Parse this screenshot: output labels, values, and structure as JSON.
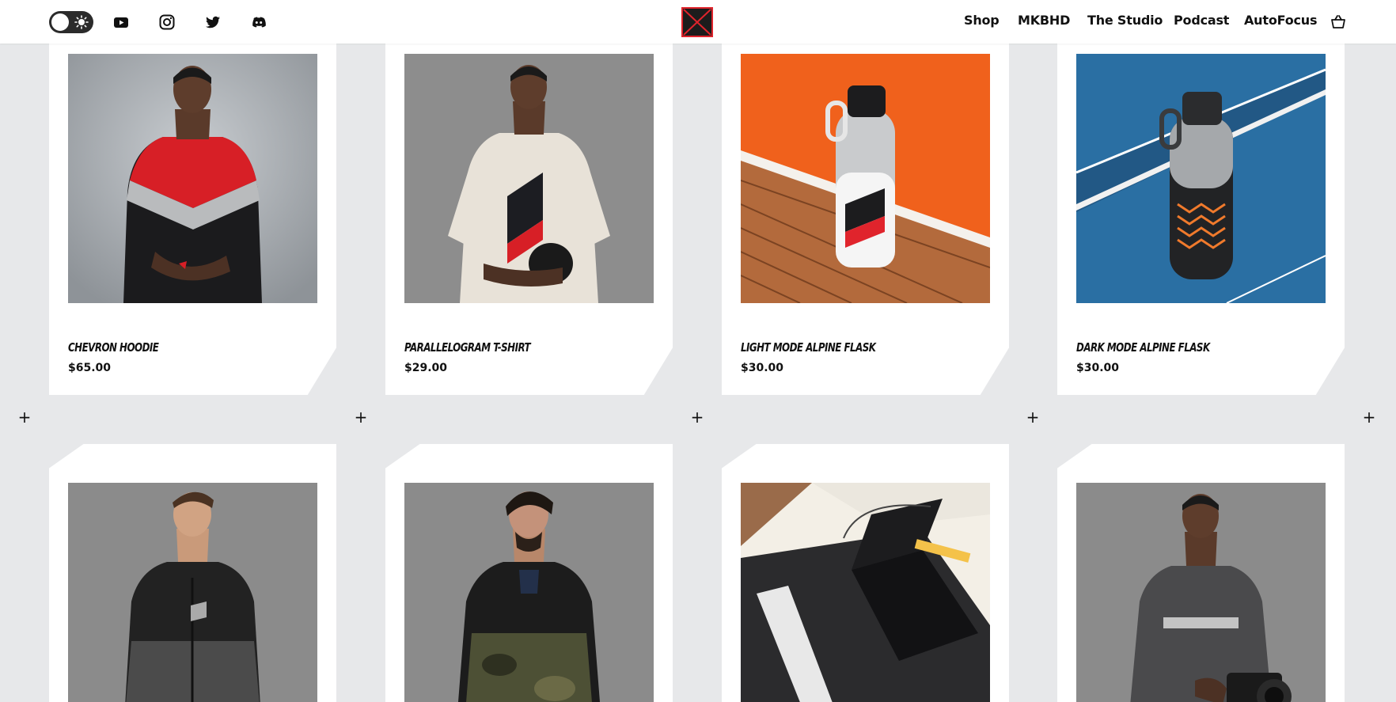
{
  "header": {
    "theme_toggle_icon": "sun-icon",
    "social": [
      "youtube-icon",
      "instagram-icon",
      "twitter-icon",
      "discord-icon"
    ],
    "logo_icon": "mkbhd-logo",
    "nav": [
      "Shop",
      "MKBHD",
      "The Studio",
      "Podcast",
      "AutoFocus"
    ],
    "cart_icon": "basket-icon"
  },
  "products": [
    {
      "name": "CHEVRON HOODIE",
      "price": "$65.00"
    },
    {
      "name": "PARALLELOGRAM T-SHIRT",
      "price": "$29.00"
    },
    {
      "name": "LIGHT MODE ALPINE FLASK",
      "price": "$30.00"
    },
    {
      "name": "DARK MODE ALPINE FLASK",
      "price": "$30.00"
    }
  ],
  "divider_symbol": "+",
  "colors": {
    "background": "#e7e8ea",
    "card": "#ffffff",
    "brand_red": "#e0242c",
    "text": "#111111"
  }
}
